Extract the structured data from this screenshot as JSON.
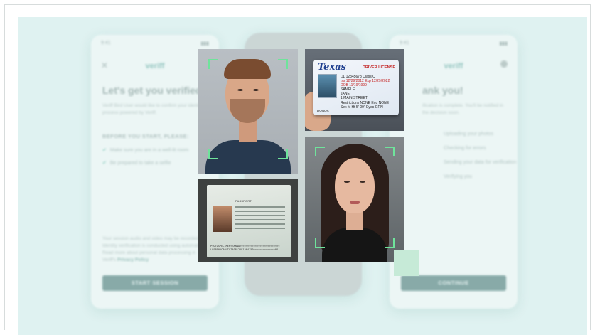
{
  "phone_left": {
    "status_time": "9:41",
    "brand": "veriff",
    "title": "Let's get you verified!",
    "intro": "Veriff Bird User would like to confirm your identity, a process powered by Veriff.",
    "subheading": "BEFORE YOU START, PLEASE:",
    "checks": [
      "Make sure you are in a well-lit room",
      "Be prepared to take a selfie"
    ],
    "footer_text": "Your session audio and video may be recorded. Identity verification is conducted using automation. Read more about personal data processing in Veriff's",
    "footer_link": "Privacy Policy",
    "button": "START SESSION"
  },
  "phone_right": {
    "status_time": "9:41",
    "brand": "veriff",
    "title": "ank you!",
    "intro": "ification is complete. You'll be notified in the decision soon.",
    "steps": [
      "Uploading your photos",
      "Checking for errors",
      "Sending your data for verification",
      "Verifying you"
    ],
    "button": "CONTINUE"
  },
  "license": {
    "state": "Texas",
    "type": "DRIVER LICENSE",
    "lines": [
      "DL 12345678   Class C",
      "Iss 12/29/2012   Exp 12/29/2022",
      "DOB 11/19/1999",
      "SAMPLE",
      "JANE",
      "1 MAIN STREET",
      "Restrictions NONE   End NONE",
      "Sex M   Ht 5'-09\"   Eyes GRN"
    ],
    "footer": "DONOR"
  },
  "passport": {
    "header": "PASSPORT",
    "mrz": [
      "P<UTOSPECIMEN<<ANNA<<<<<<<<<<<<<<<<<<<<<<<<<<",
      "L898902C36UTO7408122F1204159<<<<<<<<<<<<<<06"
    ]
  }
}
